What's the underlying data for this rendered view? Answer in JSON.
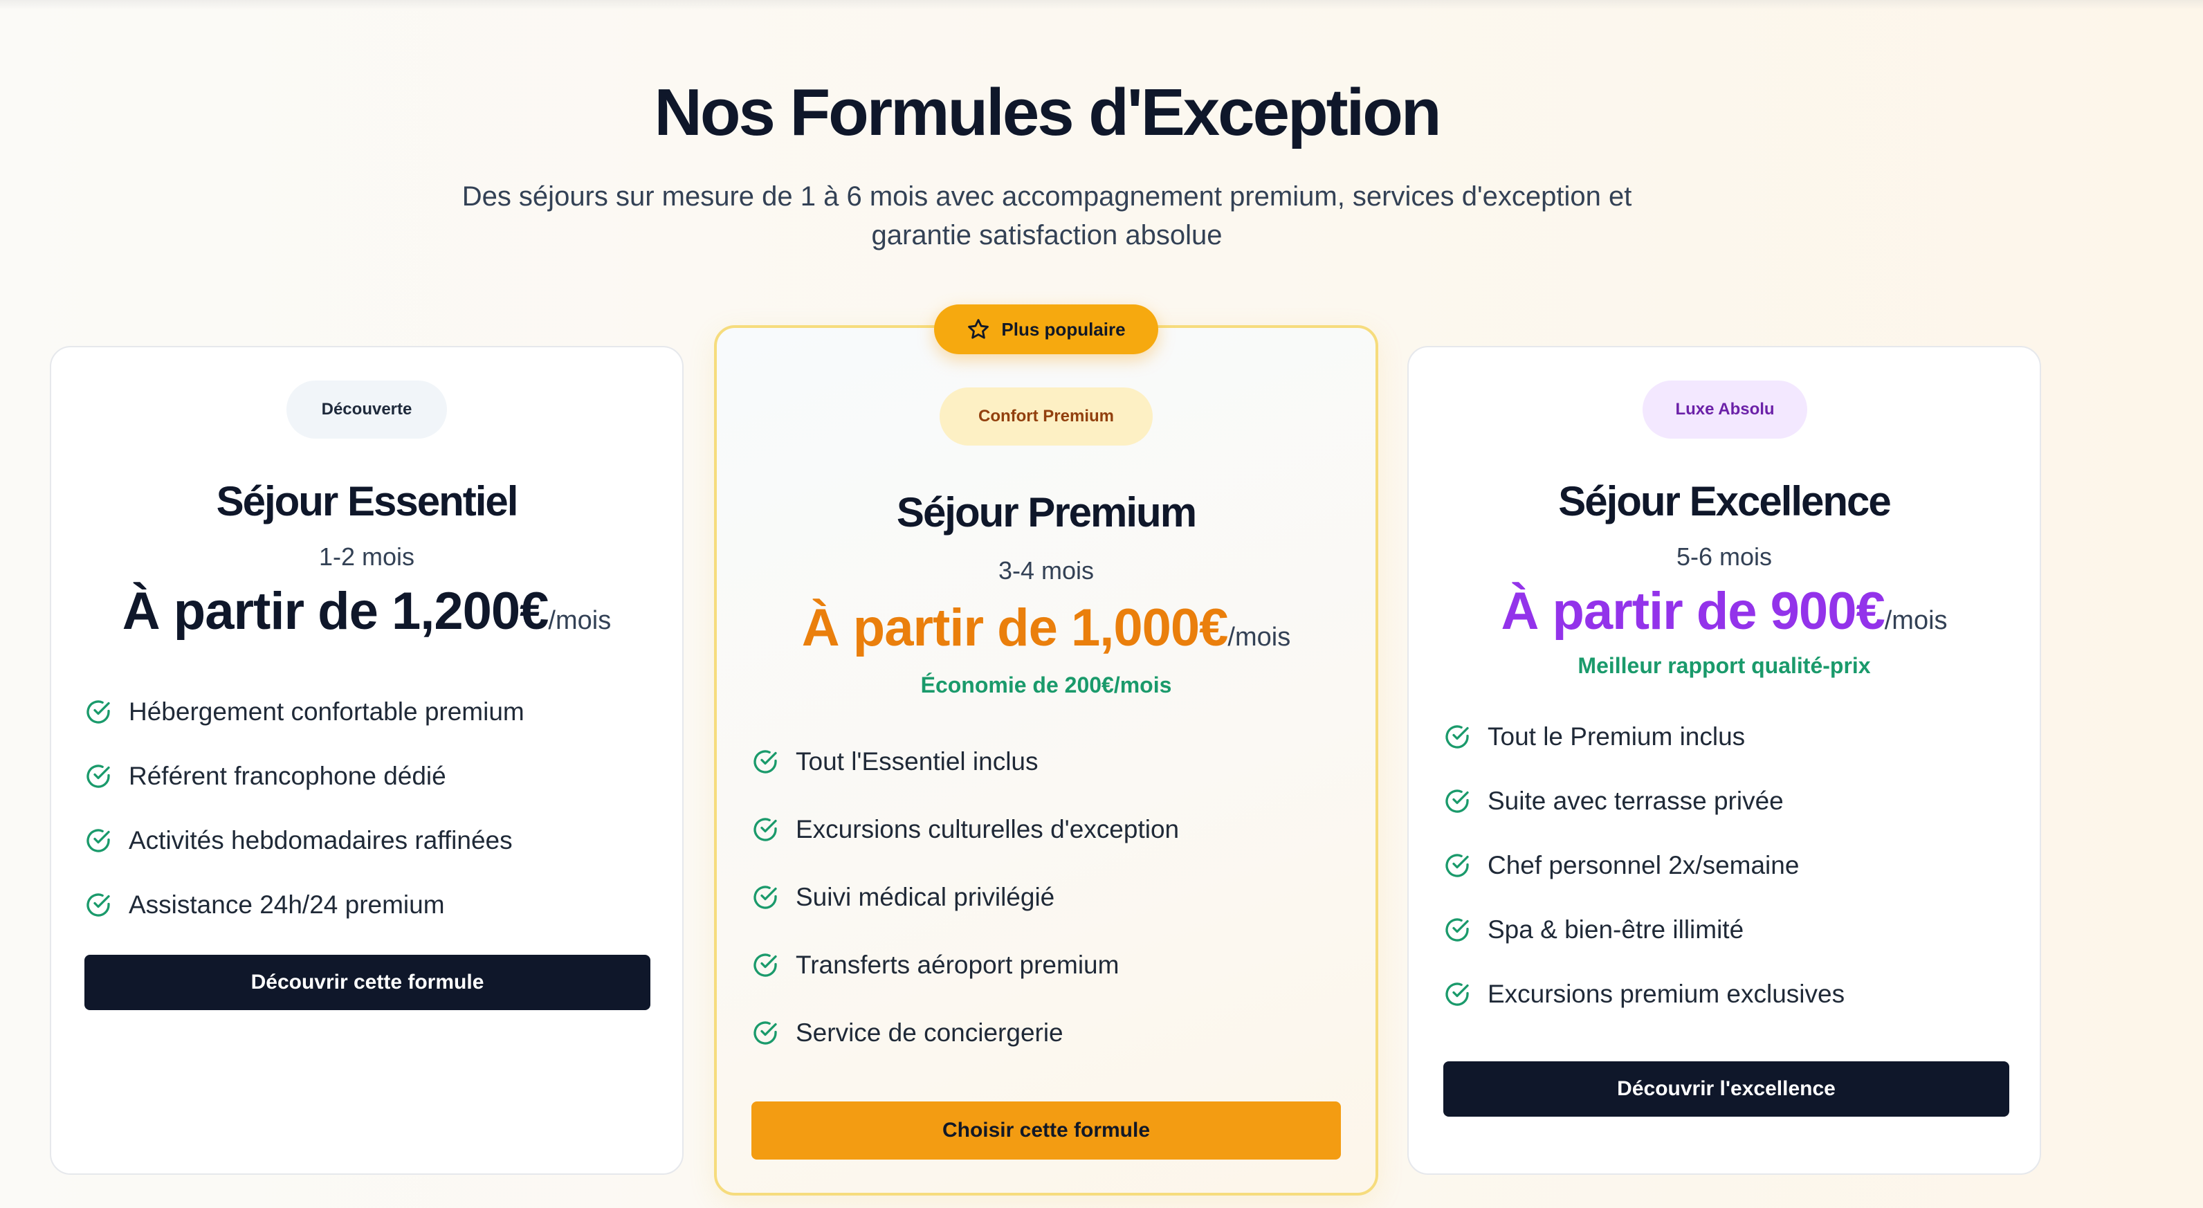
{
  "header": {
    "title": "Nos Formules d'Exception",
    "subtitle_line1": "Des séjours sur mesure de 1 à 6 mois avec accompagnement premium, services d'exception et",
    "subtitle_line2": "garantie satisfaction absolue"
  },
  "popular_badge": {
    "label": "Plus populaire",
    "icon": "star-icon"
  },
  "colors": {
    "accent_orange": "#f39c12",
    "accent_purple": "#9333ea",
    "accent_green": "#1a9a6b",
    "dark": "#0f172a"
  },
  "plans": [
    {
      "tag": "Découverte",
      "name": "Séjour Essentiel",
      "duration": "1-2 mois",
      "price": "À partir de 1,200€",
      "per": "/mois",
      "note": "",
      "features": [
        "Hébergement confortable premium",
        "Référent francophone dédié",
        "Activités hebdomadaires raffinées",
        "Assistance 24h/24 premium"
      ],
      "cta": "Découvrir cette formule"
    },
    {
      "tag": "Confort Premium",
      "name": "Séjour Premium",
      "duration": "3-4 mois",
      "price": "À partir de 1,000€",
      "per": "/mois",
      "note": "Économie de 200€/mois",
      "features": [
        "Tout l'Essentiel inclus",
        "Excursions culturelles d'exception",
        "Suivi médical privilégié",
        "Transferts aéroport premium",
        "Service de conciergerie"
      ],
      "cta": "Choisir cette formule"
    },
    {
      "tag": "Luxe Absolu",
      "name": "Séjour Excellence",
      "duration": "5-6 mois",
      "price": "À partir de 900€",
      "per": "/mois",
      "note": "Meilleur rapport qualité-prix",
      "features": [
        "Tout le Premium inclus",
        "Suite avec terrasse privée",
        "Chef personnel 2x/semaine",
        "Spa & bien-être illimité",
        "Excursions premium exclusives"
      ],
      "cta": "Découvrir l'excellence"
    }
  ]
}
